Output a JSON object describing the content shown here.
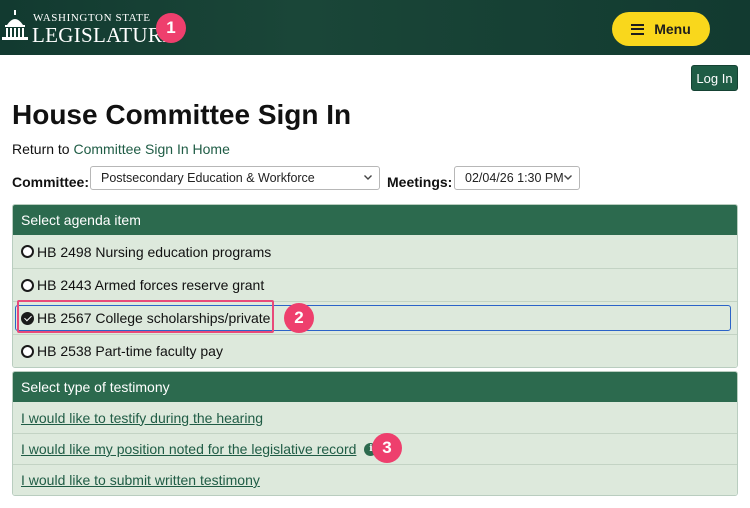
{
  "header": {
    "logo_top": "WASHINGTON STATE",
    "logo_bottom": "LEGISLATURE",
    "menu_label": "Menu"
  },
  "annotations": [
    "1",
    "2",
    "3"
  ],
  "login_label": "Log In",
  "page_title": "House Committee Sign In",
  "return": {
    "prefix": "Return to",
    "link": "Committee Sign In Home"
  },
  "filters": {
    "committee_label": "Committee:",
    "committee_value": "Postsecondary Education & Workforce",
    "meetings_label": "Meetings:",
    "meetings_value": "02/04/26 1:30 PM"
  },
  "agenda": {
    "heading": "Select agenda item",
    "items": [
      {
        "label": "HB 2498 Nursing education programs",
        "checked": false
      },
      {
        "label": "HB 2443 Armed forces reserve grant",
        "checked": false
      },
      {
        "label": "HB 2567 College scholarships/private",
        "checked": true
      },
      {
        "label": "HB 2538 Part-time faculty pay",
        "checked": false
      }
    ]
  },
  "testimony": {
    "heading": "Select type of testimony",
    "options": [
      "I would like to testify during the hearing",
      "I would like my position noted for the legislative record",
      "I would like to submit written testimony"
    ]
  },
  "colors": {
    "header_bg": "#123a30",
    "accent_green": "#2c6a4e",
    "menu_yellow": "#f9d71c",
    "badge_pink": "#ee3f6d",
    "row_bg": "#dde9dc"
  }
}
